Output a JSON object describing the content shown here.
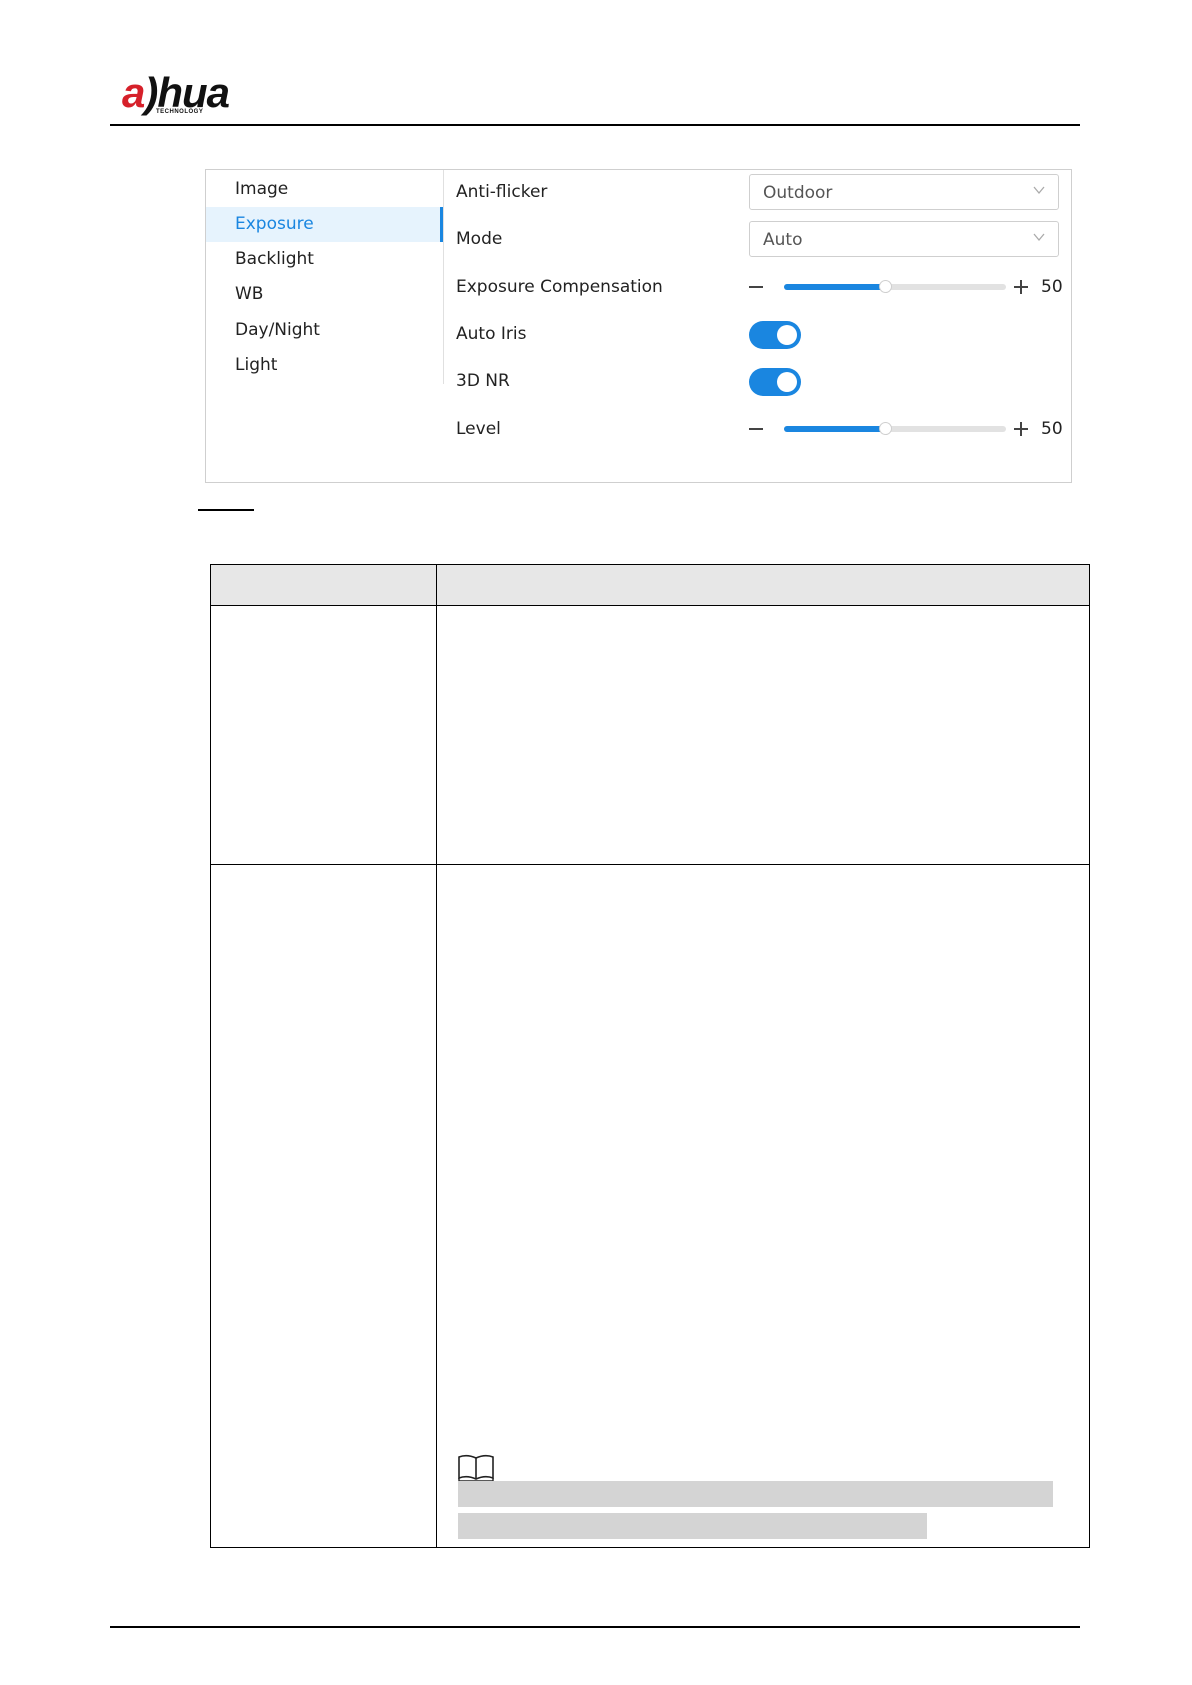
{
  "header": {
    "logo_text": "alhua",
    "logo_subtext": "TECHNOLOGY"
  },
  "panel": {
    "nav": {
      "items": [
        {
          "label": "Image",
          "active": false
        },
        {
          "label": "Exposure",
          "active": true
        },
        {
          "label": "Backlight",
          "active": false
        },
        {
          "label": "WB",
          "active": false
        },
        {
          "label": "Day/Night",
          "active": false
        },
        {
          "label": "Light",
          "active": false
        }
      ]
    },
    "fields": {
      "anti_flicker": {
        "label": "Anti-flicker",
        "value": "Outdoor"
      },
      "mode": {
        "label": "Mode",
        "value": "Auto"
      },
      "exposure_compensation": {
        "label": "Exposure Compensation",
        "value": "50",
        "level_percent": 46
      },
      "auto_iris": {
        "label": "Auto Iris",
        "on": true
      },
      "nr_3d": {
        "label": "3D NR",
        "on": true
      },
      "level": {
        "label": "Level",
        "value": "50",
        "level_percent": 46
      }
    },
    "colors": {
      "accent": "#1a86e0",
      "active_bg": "#e6f3fd"
    }
  },
  "icons": {
    "chevron": "chevron-down-icon",
    "minus": "minus-icon",
    "plus": "plus-icon",
    "note": "book-icon"
  }
}
